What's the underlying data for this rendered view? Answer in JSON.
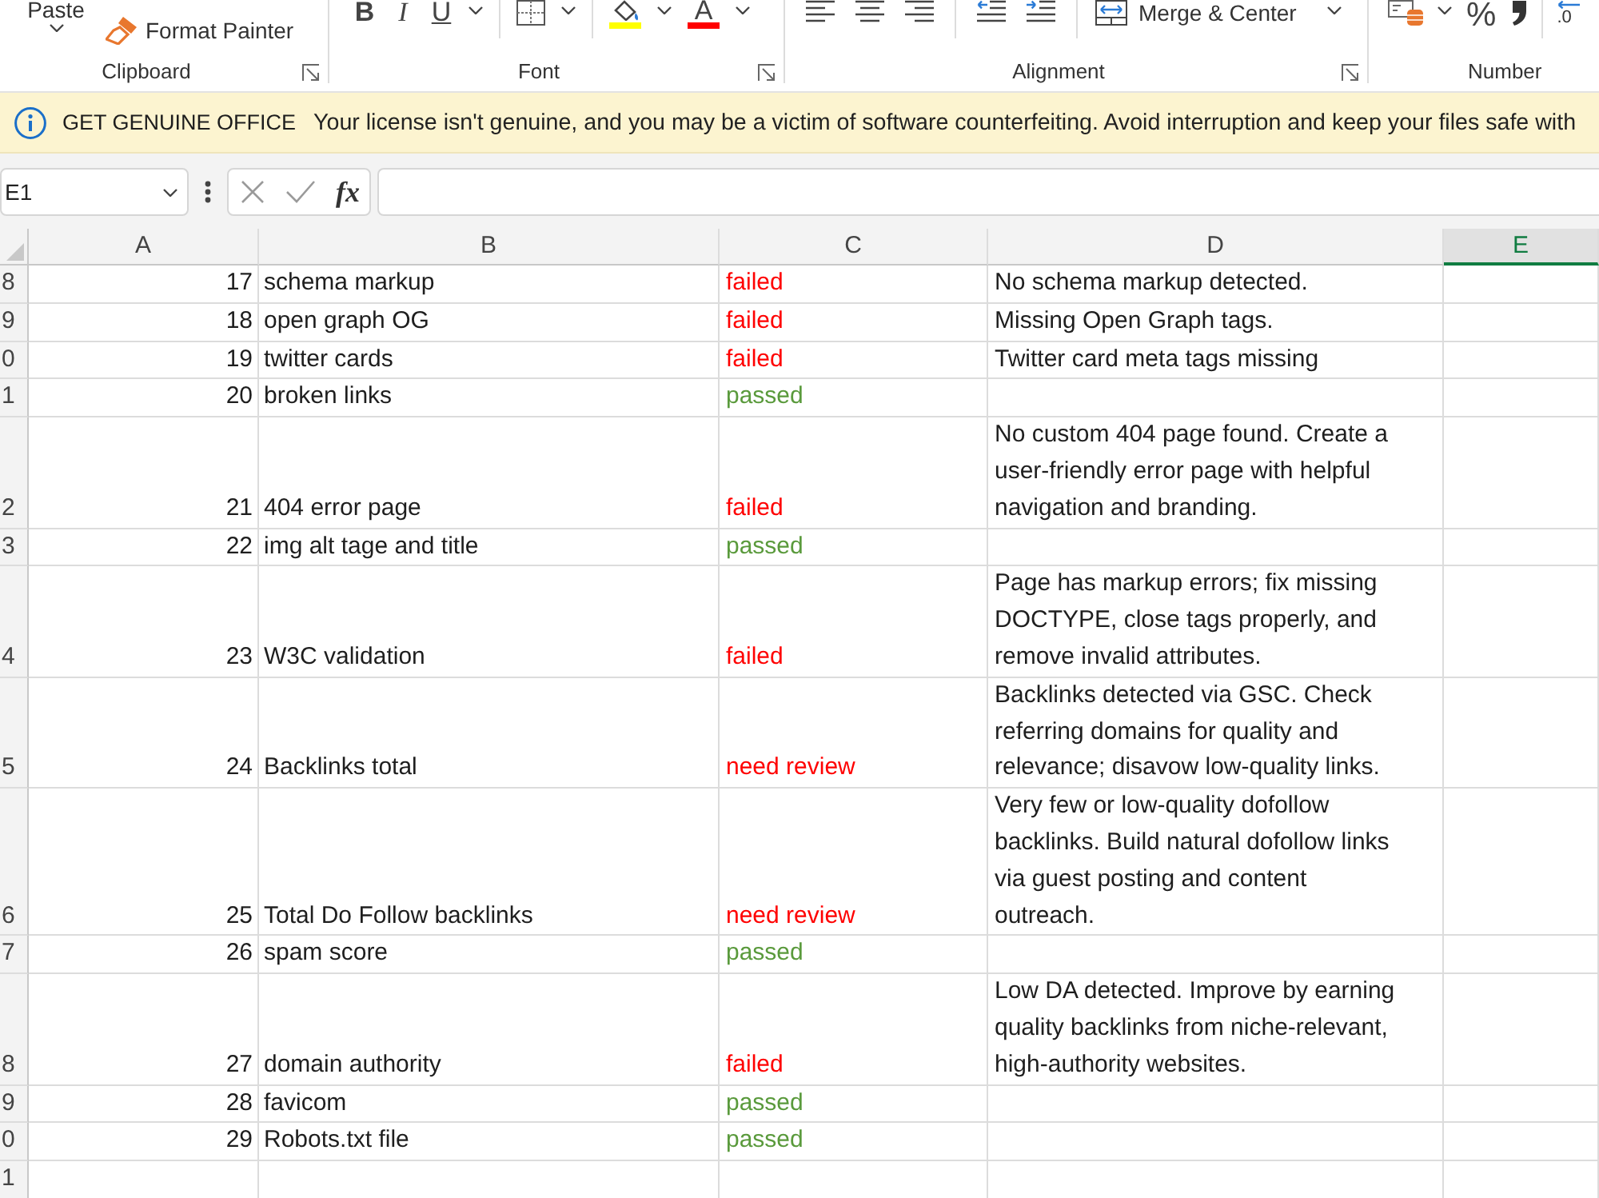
{
  "ribbon": {
    "groups": [
      {
        "label": "Clipboard",
        "launcher": true,
        "tools": [
          {
            "kind": "paste",
            "label": "Paste"
          },
          {
            "kind": "painter",
            "label": "Format Painter"
          }
        ]
      },
      {
        "label": "Font",
        "launcher": true,
        "tools": [
          {
            "kind": "bold",
            "label": "B"
          },
          {
            "kind": "italic",
            "label": "I"
          },
          {
            "kind": "underline",
            "label": "U"
          },
          {
            "kind": "dropdown"
          },
          {
            "kind": "separator"
          },
          {
            "kind": "borders"
          },
          {
            "kind": "dropdown"
          },
          {
            "kind": "separator"
          },
          {
            "kind": "fill",
            "color": "#ffff00"
          },
          {
            "kind": "dropdown"
          },
          {
            "kind": "font_color",
            "label": "A",
            "color": "#ff0000"
          },
          {
            "kind": "dropdown"
          }
        ]
      },
      {
        "label": "Alignment",
        "launcher": true,
        "tools": [
          {
            "kind": "align_left"
          },
          {
            "kind": "align_center"
          },
          {
            "kind": "align_right"
          },
          {
            "kind": "separator"
          },
          {
            "kind": "outdent"
          },
          {
            "kind": "indent"
          },
          {
            "kind": "separator"
          },
          {
            "kind": "merge",
            "label": "Merge & Center"
          },
          {
            "kind": "dropdown"
          }
        ]
      },
      {
        "label": "Number",
        "launcher": false,
        "tools": [
          {
            "kind": "accounting"
          },
          {
            "kind": "dropdown"
          },
          {
            "kind": "percent",
            "label": "%"
          },
          {
            "kind": "comma"
          },
          {
            "kind": "separator"
          },
          {
            "kind": "decimal",
            "label": ".0"
          }
        ]
      }
    ]
  },
  "message_bar": {
    "title": "GET GENUINE OFFICE",
    "text": "Your license isn't genuine, and you may be a victim of software counterfeiting. Avoid interruption and keep your files safe with"
  },
  "formula_bar": {
    "name_box": "E1",
    "function_label": "fx"
  },
  "sheet": {
    "columns": [
      {
        "label": "A",
        "selected": false
      },
      {
        "label": "B",
        "selected": false
      },
      {
        "label": "C",
        "selected": false
      },
      {
        "label": "D",
        "selected": false
      },
      {
        "label": "E",
        "selected": true
      }
    ],
    "rows": [
      {
        "header": "8",
        "cells": [
          {
            "text": "17"
          },
          {
            "text": "schema markup"
          },
          {
            "text": "failed",
            "color": "#ff0000"
          },
          {
            "text": "No schema markup detected."
          }
        ]
      },
      {
        "header": "9",
        "cells": [
          {
            "text": "18"
          },
          {
            "text": "open graph OG"
          },
          {
            "text": "failed",
            "color": "#ff0000"
          },
          {
            "text": "Missing Open Graph tags."
          }
        ]
      },
      {
        "header": "0",
        "cells": [
          {
            "text": "19"
          },
          {
            "text": "twitter cards"
          },
          {
            "text": "failed",
            "color": "#ff0000"
          },
          {
            "text": "Twitter card meta tags missing"
          }
        ]
      },
      {
        "header": "1",
        "cells": [
          {
            "text": "20"
          },
          {
            "text": "broken links"
          },
          {
            "text": "passed",
            "color": "#5a9a3c"
          }
        ]
      },
      {
        "header": "2",
        "cells": [
          {
            "text": "21"
          },
          {
            "text": "404 error page"
          },
          {
            "text": "failed",
            "color": "#ff0000"
          },
          {
            "text": "No custom 404 page found. Create a user-friendly error page with helpful navigation and branding."
          }
        ]
      },
      {
        "header": "3",
        "cells": [
          {
            "text": "22"
          },
          {
            "text": "img alt tage and title"
          },
          {
            "text": "passed",
            "color": "#5a9a3c"
          }
        ]
      },
      {
        "header": "4",
        "cells": [
          {
            "text": "23"
          },
          {
            "text": "W3C validation"
          },
          {
            "text": "failed",
            "color": "#ff0000"
          },
          {
            "text": "Page has markup errors; fix missing DOCTYPE, close tags properly, and remove invalid attributes."
          }
        ]
      },
      {
        "header": "5",
        "cells": [
          {
            "text": "24"
          },
          {
            "text": "Backlinks total"
          },
          {
            "text": "need review",
            "color": "#ff0000"
          },
          {
            "text": "Backlinks detected via GSC. Check referring domains for quality and relevance; disavow low-quality links."
          }
        ]
      },
      {
        "header": "6",
        "cells": [
          {
            "text": "25"
          },
          {
            "text": "Total Do Follow backlinks"
          },
          {
            "text": "need review",
            "color": "#ff0000"
          },
          {
            "text": "Very few or low-quality dofollow backlinks. Build natural dofollow links via guest posting and content outreach."
          }
        ]
      },
      {
        "header": "7",
        "cells": [
          {
            "text": "26"
          },
          {
            "text": "spam score"
          },
          {
            "text": "passed",
            "color": "#5a9a3c"
          }
        ]
      },
      {
        "header": "8",
        "cells": [
          {
            "text": "27"
          },
          {
            "text": "domain authority"
          },
          {
            "text": "failed",
            "color": "#ff0000"
          },
          {
            "text": "Low DA detected. Improve by earning quality backlinks from niche-relevant, high-authority websites."
          }
        ]
      },
      {
        "header": "9",
        "cells": [
          {
            "text": "28"
          },
          {
            "text": "favicom"
          },
          {
            "text": "passed",
            "color": "#5a9a3c"
          }
        ]
      },
      {
        "header": "0",
        "cells": [
          {
            "text": "29"
          },
          {
            "text": "Robots.txt file"
          },
          {
            "text": "passed",
            "color": "#5a9a3c"
          }
        ]
      },
      {
        "header": "1"
      }
    ]
  }
}
